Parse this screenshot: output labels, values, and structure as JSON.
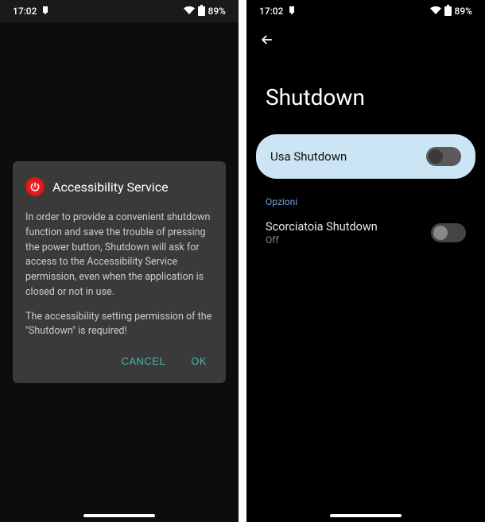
{
  "statusbar": {
    "time": "17:02",
    "battery": "89%"
  },
  "dialog": {
    "title": "Accessibility Service",
    "body1": "In order to provide a convenient shutdown function and save the trouble of pressing the power button, Shutdown will ask for access to the Accessibility Service permission, even when the application is closed or not in use.",
    "body2": "The accessibility setting permission of the \"Shutdown\" is required!",
    "cancel": "CANCEL",
    "ok": "OK"
  },
  "settings": {
    "title": "Shutdown",
    "main_toggle_label": "Usa Shutdown",
    "section_label": "Opzioni",
    "shortcut_title": "Scorciatoia Shutdown",
    "shortcut_sub": "Off"
  }
}
